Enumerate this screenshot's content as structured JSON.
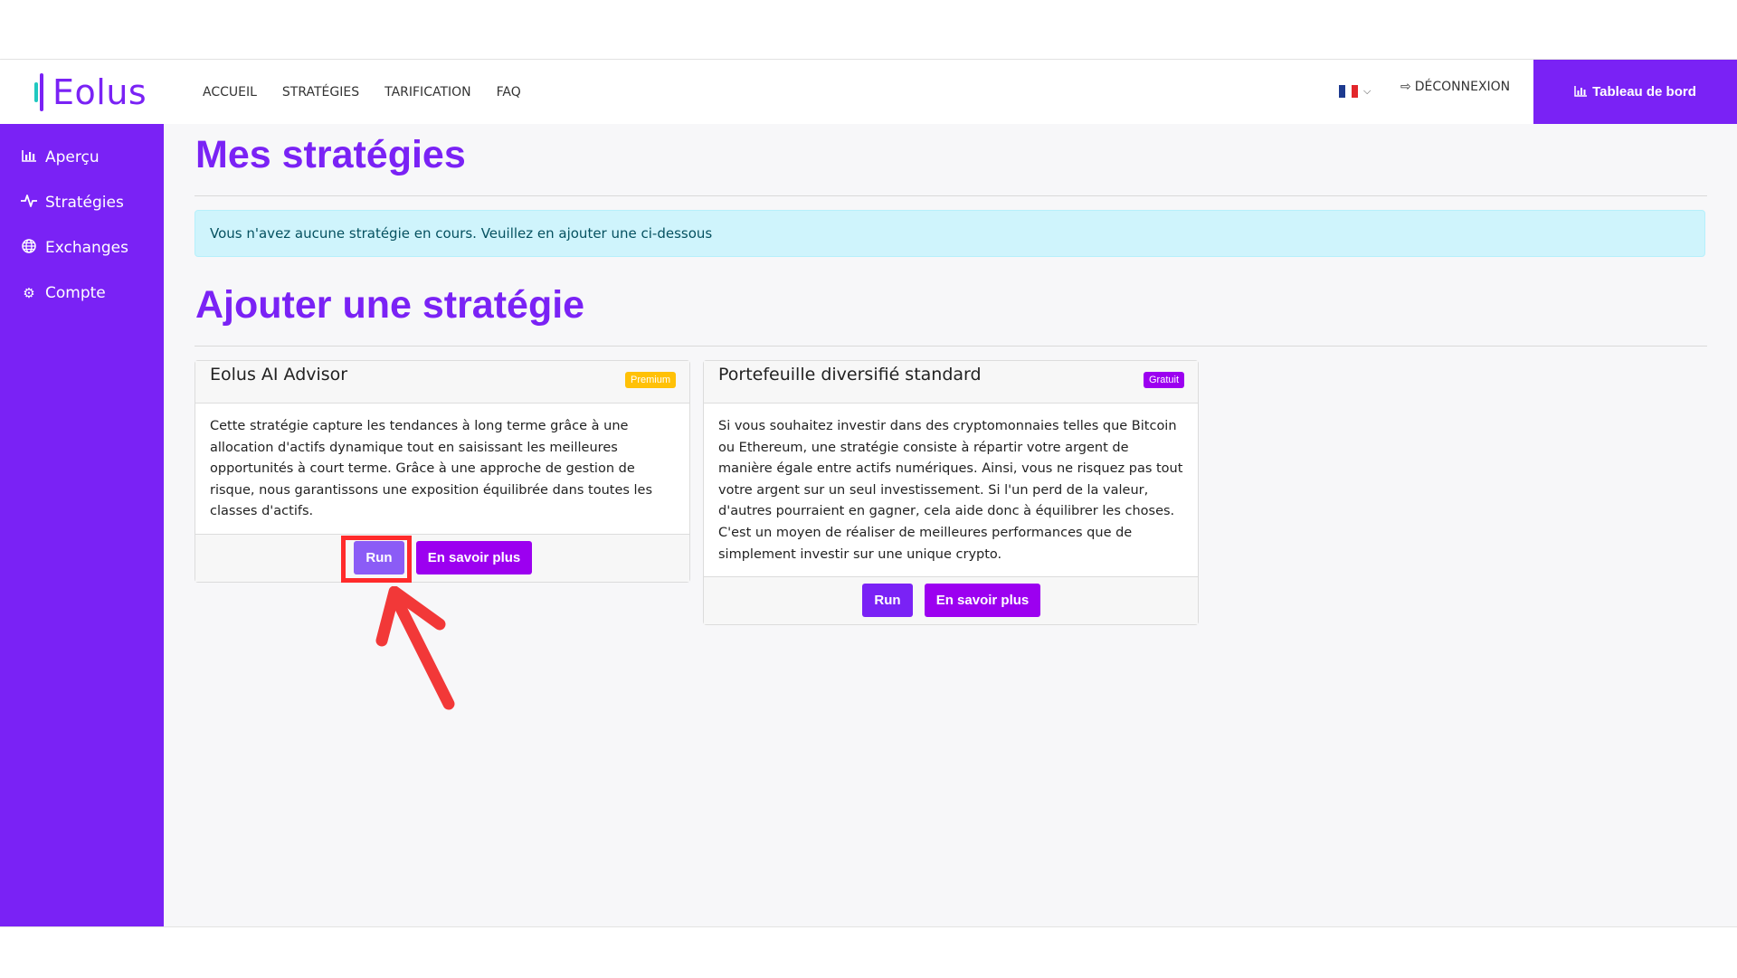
{
  "header": {
    "logo_text": "Eolus",
    "nav": [
      "ACCUEIL",
      "STRATÉGIES",
      "TARIFICATION",
      "FAQ"
    ],
    "logout_label": "DÉCONNEXION",
    "dashboard_label": "Tableau de bord"
  },
  "sidebar": {
    "items": [
      {
        "label": "Aperçu",
        "icon": "chart-bar-icon"
      },
      {
        "label": "Stratégies",
        "icon": "pulse-icon"
      },
      {
        "label": "Exchanges",
        "icon": "globe-icon"
      },
      {
        "label": "Compte",
        "icon": "gear-icon"
      }
    ]
  },
  "main": {
    "title": "Mes stratégies",
    "alert": "Vous n'avez aucune stratégie en cours. Veuillez en ajouter une ci-dessous",
    "add_title": "Ajouter une stratégie",
    "cards": [
      {
        "title": "Eolus AI Advisor",
        "badge": "Premium",
        "description": "Cette stratégie capture les tendances à long terme grâce à une allocation d'actifs dynamique tout en saisissant les meilleures opportunités à court terme. Grâce à une approche de gestion de risque, nous garantissons une exposition équilibrée dans toutes les classes d'actifs.",
        "run_label": "Run",
        "more_label": "En savoir plus"
      },
      {
        "title": "Portefeuille diversifié standard",
        "badge": "Gratuit",
        "description": "Si vous souhaitez investir dans des cryptomonnaies telles que Bitcoin ou Ethereum, une stratégie consiste à répartir votre argent de manière égale entre actifs numériques. Ainsi, vous ne risquez pas tout votre argent sur un seul investissement. Si l'un perd de la valeur, d'autres pourraient en gagner, cela aide donc à équilibrer les choses. C'est un moyen de réaliser de meilleures performances que de simplement investir sur une unique crypto.",
        "run_label": "Run",
        "more_label": "En savoir plus"
      }
    ]
  },
  "colors": {
    "brand": "#7a22f5",
    "accent": "#9c00f0",
    "alert_bg": "#cff4fc",
    "highlight": "#ff2b2b"
  }
}
